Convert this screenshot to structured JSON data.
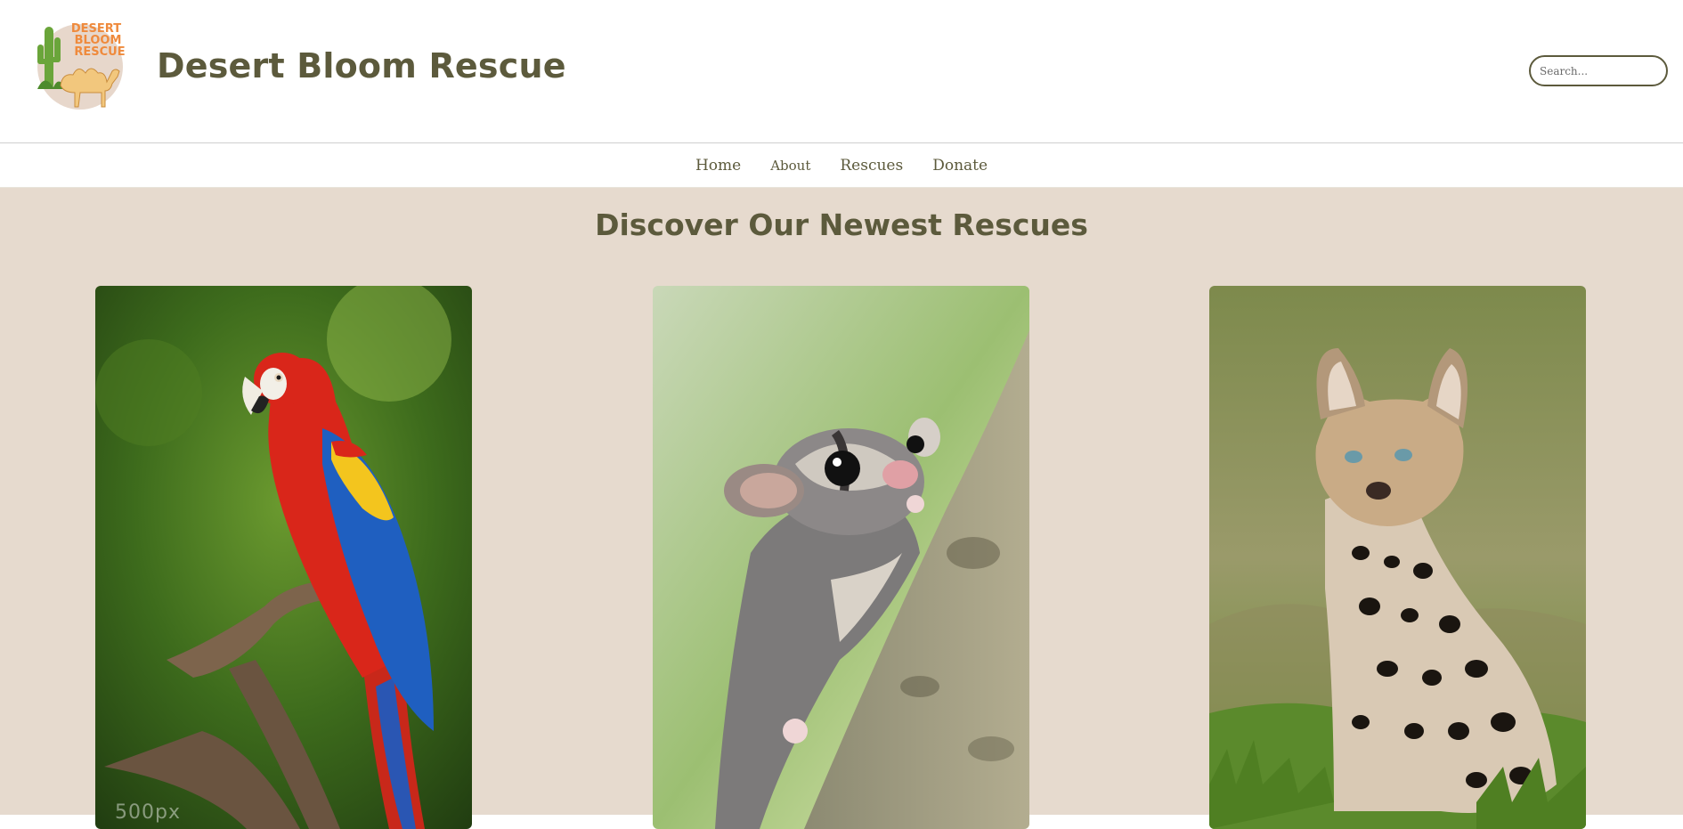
{
  "header": {
    "logo": {
      "icon": "camel-cactus-logo-icon",
      "line1": "DESERT",
      "line2": "BLOOM",
      "line3": "RESCUE"
    },
    "title": "Desert Bloom Rescue",
    "search_placeholder": "Search..."
  },
  "nav": {
    "items": [
      {
        "label": "Home"
      },
      {
        "label": "About"
      },
      {
        "label": "Rescues"
      },
      {
        "label": "Donate"
      }
    ]
  },
  "main": {
    "title": "Discover Our Newest Rescues",
    "cards": [
      {
        "image": "scarlet-macaw-photo",
        "watermark": "500px"
      },
      {
        "image": "sugar-glider-photo"
      },
      {
        "image": "serval-cat-photo"
      }
    ]
  },
  "colors": {
    "brand_text": "#5c5a3c",
    "section_bg": "#e6dace",
    "logo_orange": "#ef8a3c"
  }
}
